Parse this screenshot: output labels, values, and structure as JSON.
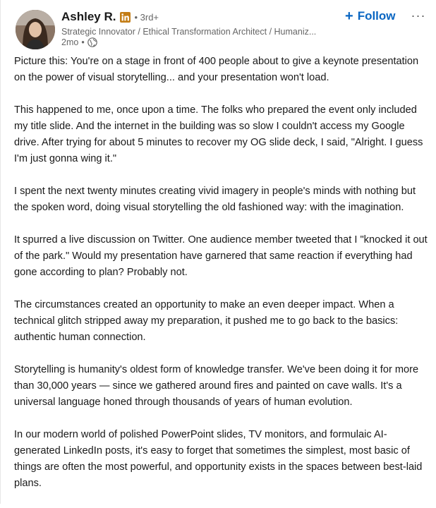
{
  "post": {
    "author": {
      "name": "Ashley R.",
      "badge_icon": "linkedin-premium-icon",
      "degree": "• 3rd+",
      "headline": "Strategic Innovator / Ethical Transformation Architect / Humaniz...",
      "time": "2mo",
      "visibility_icon": "globe-icon",
      "meta_dot": "•"
    },
    "actions": {
      "follow_plus": "+",
      "follow_label": "Follow",
      "more_icon": "ellipsis-icon",
      "more_text": "···"
    },
    "paragraphs": [
      "Picture this: You're on a stage in front of 400 people about to give a keynote presentation on the power of visual storytelling... and your presentation won't load.",
      "This happened to me, once upon a time. The folks who prepared the event only included my title slide. And the internet in the building was so slow I couldn't access my Google drive. After trying for about 5 minutes to recover my OG slide deck, I said, \"Alright. I guess I'm just gonna wing it.\"",
      "I spent the next twenty minutes creating vivid imagery in people's minds with nothing but the spoken word, doing visual storytelling the old fashioned way: with the imagination.",
      "It spurred a live discussion on Twitter. One audience member tweeted that I \"knocked it out of the park.\" Would my presentation have garnered that same reaction if everything had gone according to plan? Probably not.",
      "The circumstances created an opportunity to make an even deeper impact. When a technical glitch stripped away my preparation, it pushed me to go back to the basics: authentic human connection.",
      "Storytelling is humanity's oldest form of knowledge transfer. We've been doing it for more than 30,000 years — since we gathered around fires and painted on cave walls. It's a universal language honed through thousands of years of human evolution.",
      "In our modern world of polished PowerPoint slides, TV monitors, and formulaic AI-generated LinkedIn posts, it's easy to forget that sometimes the simplest, most basic of things are often the most powerful, and opportunity exists in the spaces between best-laid plans."
    ]
  },
  "colors": {
    "brand_blue": "#0a66c2",
    "premium_gold": "#c37d16",
    "text_primary": "#191919",
    "text_secondary": "#666666"
  }
}
